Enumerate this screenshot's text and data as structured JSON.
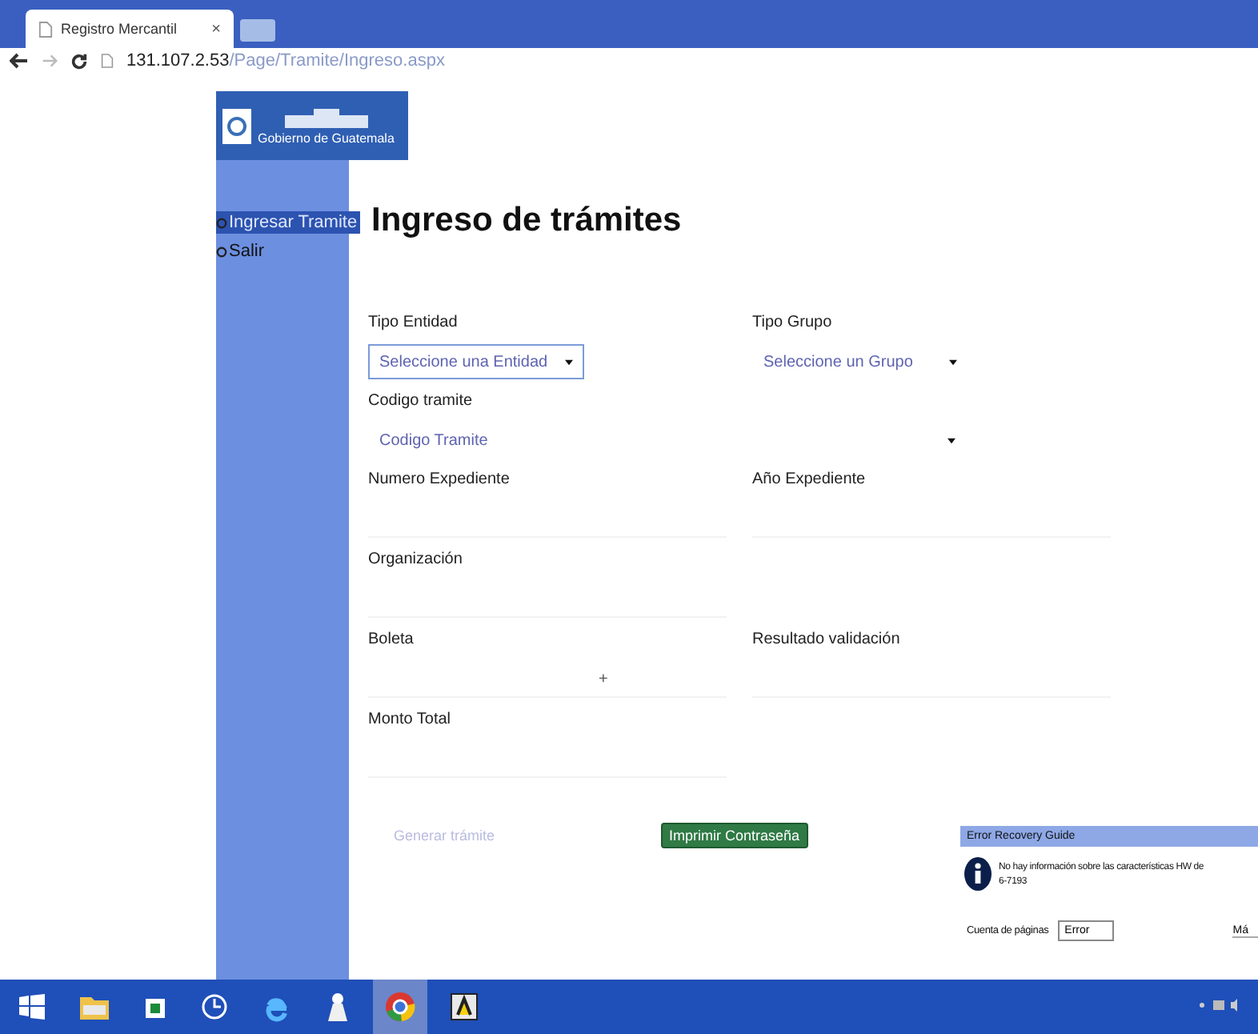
{
  "browser": {
    "tab_title": "Registro Mercantil",
    "tab_close": "×",
    "url_host": "131.107.2.53",
    "url_path": "/Page/Tramite/Ingreso.aspx"
  },
  "header": {
    "logo_text": "Gobierno de Guatemala"
  },
  "sidebar": {
    "items": [
      {
        "label": "Ingresar Tramite",
        "selected": true
      },
      {
        "label": "Salir",
        "selected": false
      }
    ]
  },
  "title": "Ingreso de trámites",
  "form": {
    "rows": [
      {
        "fields": [
          {
            "label": "Tipo Entidad",
            "kind": "select",
            "placeholder": "Seleccione una Entidad",
            "focused": true
          },
          {
            "label": "Tipo Grupo",
            "kind": "select",
            "placeholder": "Seleccione un Grupo",
            "focused": false
          }
        ]
      },
      {
        "fields": [
          {
            "label": "Codigo tramite",
            "kind": "select",
            "placeholder": "Codigo Tramite",
            "focused": false
          }
        ]
      },
      {
        "fields": [
          {
            "label": "Numero Expediente",
            "kind": "input"
          },
          {
            "label": "Año Expediente",
            "kind": "input"
          }
        ]
      },
      {
        "fields": [
          {
            "label": "Organización",
            "kind": "input"
          }
        ]
      },
      {
        "fields": [
          {
            "label": "Boleta",
            "kind": "input-add",
            "button": "+"
          },
          {
            "label": "Resultado validación",
            "kind": "input"
          }
        ]
      },
      {
        "fields": [
          {
            "label": "Monto Total",
            "kind": "input"
          }
        ]
      }
    ],
    "buttons": [
      {
        "label": "Generar trámite",
        "disabled": true
      },
      {
        "label": "Imprimir Contraseña",
        "disabled": false
      }
    ]
  },
  "error_dialog": {
    "title": "Error Recovery Guide",
    "message": "No hay información sobre las características HW de",
    "code": "6-7193",
    "page_count_label": "Cuenta de páginas",
    "page_count_value": "Error",
    "more": "Má"
  }
}
